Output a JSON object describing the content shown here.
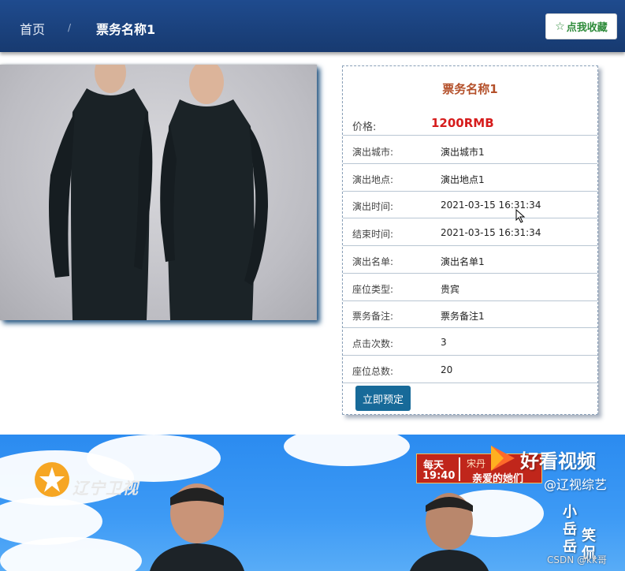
{
  "header": {
    "breadcrumb_home": "首页",
    "breadcrumb_separator": "/",
    "breadcrumb_current": "票务名称1",
    "favorite_button": "点我收藏"
  },
  "ticket": {
    "title": "票务名称1",
    "price_label": "价格:",
    "price_value": "1200RMB",
    "fields": [
      {
        "label": "演出城市:",
        "value": "演出城市1"
      },
      {
        "label": "演出地点:",
        "value": "演出地点1"
      },
      {
        "label": "演出时间:",
        "value": "2021-03-15 16:31:34"
      },
      {
        "label": "结束时间:",
        "value": "2021-03-15 16:31:34"
      },
      {
        "label": "演出名单:",
        "value": "演出名单1"
      },
      {
        "label": "座位类型:",
        "value": "贵宾"
      },
      {
        "label": "票务备注:",
        "value": "票务备注1"
      },
      {
        "label": "点击次数:",
        "value": "3"
      },
      {
        "label": "座位总数:",
        "value": "20"
      }
    ],
    "book_button": "立即预定"
  },
  "video": {
    "station": "辽宁卫视",
    "promo_day": "每天",
    "promo_time": "19:40",
    "promo_top": "宋丹",
    "promo_title": "亲爱的她们",
    "platform": "好看视频",
    "channel": "@辽视综艺",
    "side_text_1": "小岳岳",
    "side_text_2": "笑侃",
    "watermark": "CSDN @kk哥"
  },
  "colors": {
    "header_bg": "#1f4b8e",
    "price": "#d61c1c",
    "title": "#b4502a",
    "book_button": "#176a99",
    "favorite_text": "#2e8b3a"
  }
}
